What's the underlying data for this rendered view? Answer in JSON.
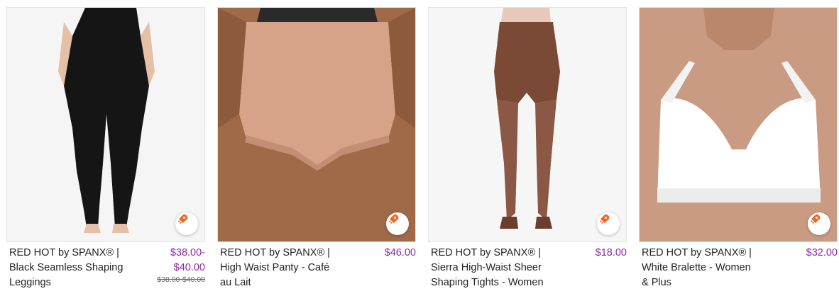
{
  "products": [
    {
      "brand": "RED HOT by SPANX® |",
      "name_line1": "Black Seamless Shaping",
      "name_line2": "Leggings",
      "price_line1": "$38.00-",
      "price_line2": "$40.00",
      "original_price": "$38.00-$40.00",
      "badge_icon": "rocket-icon"
    },
    {
      "brand": "RED HOT by SPANX® |",
      "name_line1": "High Waist Panty - Café",
      "name_line2": "au Lait",
      "price_line1": "$46.00",
      "badge_icon": "rocket-icon"
    },
    {
      "brand": "RED HOT by SPANX® |",
      "name_line1": "Sierra High-Waist Sheer",
      "name_line2": "Shaping Tights - Women",
      "price_line1": "$18.00",
      "badge_icon": "rocket-icon"
    },
    {
      "brand": "RED HOT by SPANX® |",
      "name_line1": "White Bralette - Women",
      "name_line2": "& Plus",
      "price_line1": "$32.00",
      "badge_icon": "rocket-icon"
    }
  ],
  "colors": {
    "price": "#8a2aa6",
    "rocket": "#f26522",
    "card_border": "#e2e2e2"
  }
}
